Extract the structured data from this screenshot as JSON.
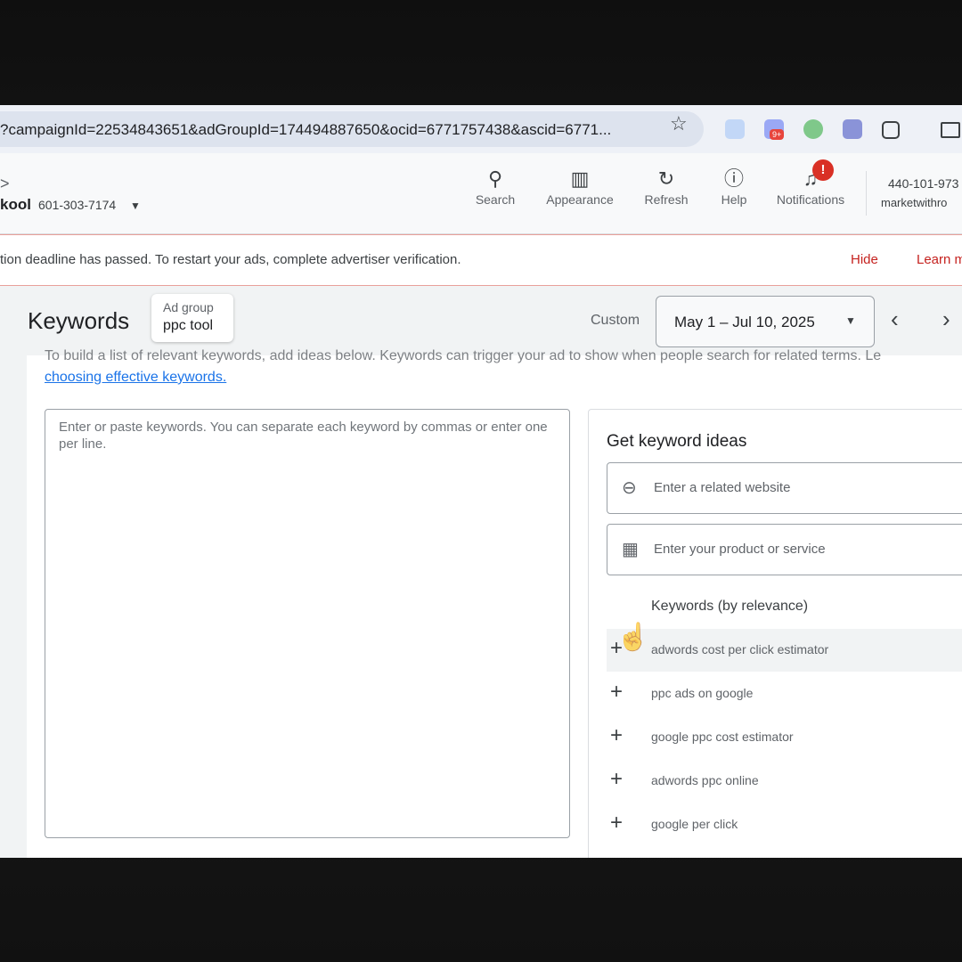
{
  "browser": {
    "url": "?campaignId=22534843651&adGroupId=174494887650&ocid=6771757438&ascid=6771...",
    "ext_badge": "9+"
  },
  "header": {
    "breadcrumb_chevron": ">",
    "account_name": "kool",
    "account_id": "601-303-7174",
    "buttons": [
      {
        "label": "Search",
        "icon": "search-icon"
      },
      {
        "label": "Appearance",
        "icon": "appearance-icon"
      },
      {
        "label": "Refresh",
        "icon": "refresh-icon"
      },
      {
        "label": "Help",
        "icon": "help-icon"
      },
      {
        "label": "Notifications",
        "icon": "bell-icon"
      }
    ],
    "notification_badge": "!",
    "right_account_id": "440-101-973",
    "right_account_name": "marketwithro"
  },
  "alert": {
    "text": "tion deadline has passed. To restart your ads, complete advertiser verification.",
    "hide": "Hide",
    "learn": "Learn m"
  },
  "page": {
    "title": "Keywords",
    "ad_group_label": "Ad group",
    "ad_group_value": "ppc tool",
    "custom_label": "Custom",
    "date_range": "May 1 – Jul 10, 2025"
  },
  "content": {
    "intro": "To build a list of relevant keywords, add ideas below. Keywords can trigger your ad to show when people search for related terms. Le",
    "intro_link": "choosing effective keywords.",
    "keyword_placeholder": "Enter or paste keywords. You can separate each keyword by commas or enter one per line.",
    "ideas_title": "Get keyword ideas",
    "website_placeholder": "Enter a related website",
    "product_placeholder": "Enter your product or service",
    "keywords_heading": "Keywords (by relevance)",
    "keywords": [
      "adwords cost per click estimator",
      "ppc ads on google",
      "google ppc cost estimator",
      "adwords ppc online",
      "google per click"
    ]
  }
}
